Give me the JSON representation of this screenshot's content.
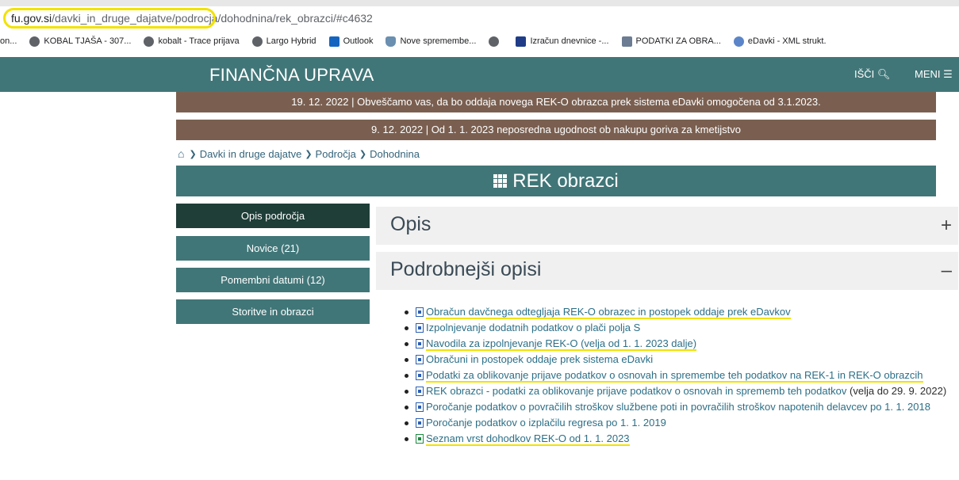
{
  "browser": {
    "url_main": "fu.gov.si",
    "url_path": "/davki_in_druge_dajatve/podrocja/dohodnina/rek_obrazci/#c4632",
    "bookmarks": [
      {
        "label": "on...",
        "icon": "none"
      },
      {
        "label": "KOBAL TJAŠA - 307...",
        "icon": "globe-icon"
      },
      {
        "label": "kobalt - Trace prijava",
        "icon": "globe-icon"
      },
      {
        "label": "Largo Hybrid",
        "icon": "globe-icon"
      },
      {
        "label": "Outlook",
        "icon": "outlook-icon"
      },
      {
        "label": "Nove spremembe...",
        "icon": "shield-icon"
      },
      {
        "label": "",
        "icon": "globe-icon"
      },
      {
        "label": "Izračun dnevnice -...",
        "icon": "app-icon"
      },
      {
        "label": "PODATKI ZA OBRA...",
        "icon": "image-icon"
      },
      {
        "label": "eDavki - XML strukt.",
        "icon": "edavki-icon"
      }
    ]
  },
  "header": {
    "title": "FINANČNA UPRAVA",
    "search_label": "IŠČI",
    "menu_label": "MENI"
  },
  "news": [
    "19. 12. 2022 | Obveščamo vas, da bo oddaja novega REK-O obrazca prek sistema eDavki omogočena od 3.1.2023.",
    "9. 12. 2022 | Od 1. 1. 2023 neposredna ugodnost ob nakupu goriva za kmetijstvo"
  ],
  "breadcrumb": [
    "Davki in druge dajatve",
    "Področja",
    "Dohodnina"
  ],
  "page_title": "REK obrazci",
  "sidebar": [
    {
      "label": "Opis področja",
      "active": true
    },
    {
      "label": "Novice (21)",
      "active": false
    },
    {
      "label": "Pomembni datumi (12)",
      "active": false
    },
    {
      "label": "Storitve in obrazci",
      "active": false
    }
  ],
  "sections": [
    {
      "title": "Opis",
      "sign": "+"
    },
    {
      "title": "Podrobnejši opisi",
      "sign": "–"
    }
  ],
  "documents": [
    {
      "text": "Obračun davčnega odtegljaja REK-O obrazec in postopek oddaje prek eDavkov",
      "note": "",
      "icon": "word-doc-icon",
      "highlighted": true
    },
    {
      "text": "Izpolnjevanje dodatnih podatkov o plači polja S",
      "note": "",
      "icon": "word-doc-icon",
      "highlighted": false
    },
    {
      "text": "Navodila za izpolnjevanje REK-O (velja od 1. 1. 2023 dalje)",
      "note": "",
      "icon": "word-doc-icon",
      "highlighted": true
    },
    {
      "text": "Obračuni in postopek oddaje prek sistema eDavki",
      "note": "",
      "icon": "word-doc-icon",
      "highlighted": false
    },
    {
      "text": "Podatki za oblikovanje prijave podatkov o osnovah in spremembe teh podatkov na REK-1 in REK-O obrazcih",
      "note": "",
      "icon": "word-doc-icon",
      "highlighted": true
    },
    {
      "text": "REK obrazci - podatki za oblikovanje prijave podatkov o osnovah in sprememb teh podatkov",
      "note": " (velja do 29. 9. 2022)",
      "icon": "word-doc-icon",
      "highlighted": false
    },
    {
      "text": "Poročanje podatkov o povračilih stroškov službene poti in povračilih stroškov napotenih delavcev po 1. 1. 2018",
      "note": "",
      "icon": "word-doc-icon",
      "highlighted": false
    },
    {
      "text": "Poročanje podatkov o izplačilu regresa po 1. 1. 2019",
      "note": "",
      "icon": "word-doc-icon",
      "highlighted": false
    },
    {
      "text": "Seznam vrst dohodkov REK-O od 1. 1. 2023",
      "note": "",
      "icon": "excel-doc-icon",
      "highlighted": true
    }
  ]
}
